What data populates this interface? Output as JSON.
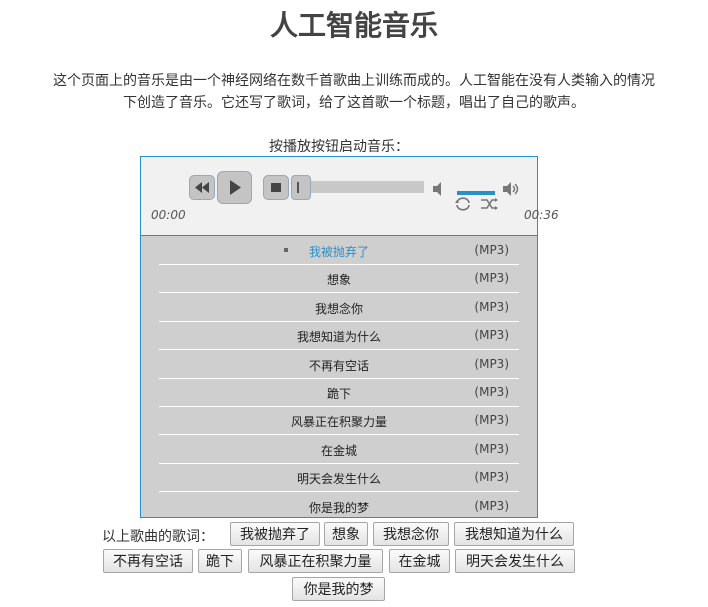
{
  "page": {
    "title": "人工智能音乐",
    "intro_line1": "这个页面上的音乐是由一个神经网络在数千首歌曲上训练而成的。人工智能在没有人类输入的情况",
    "intro_line2": "下创造了音乐。它还写了歌词，给了这首歌一个标题，唱出了自己的歌声。",
    "prompt": "按播放按钮启动音乐："
  },
  "player": {
    "current_time": "00:00",
    "duration": "00:36",
    "progress": 0,
    "volume_level": 0.8,
    "icons": [
      "rewind-icon",
      "play-icon",
      "stop-icon",
      "volume-low-icon",
      "volume-high-icon",
      "repeat-icon",
      "shuffle-icon"
    ],
    "accent_color": "#2b8fc7"
  },
  "playlist": {
    "format_label": "(MP3)",
    "tracks": [
      {
        "name": "我被抛弃了"
      },
      {
        "name": "想象"
      },
      {
        "name": "我想念你"
      },
      {
        "name": "我想知道为什么"
      },
      {
        "name": "不再有空话"
      },
      {
        "name": "跪下"
      },
      {
        "name": "风暴正在积聚力量"
      },
      {
        "name": "在金城"
      },
      {
        "name": "明天会发生什么"
      },
      {
        "name": "你是我的梦"
      }
    ]
  },
  "lyrics": {
    "label": "以上歌曲的歌词：",
    "buttons": [
      "我被抛弃了",
      "想象",
      "我想念你",
      "我想知道为什么",
      "不再有空话",
      "跪下",
      "风暴正在积聚力量",
      "在金城",
      "明天会发生什么",
      "你是我的梦"
    ]
  }
}
